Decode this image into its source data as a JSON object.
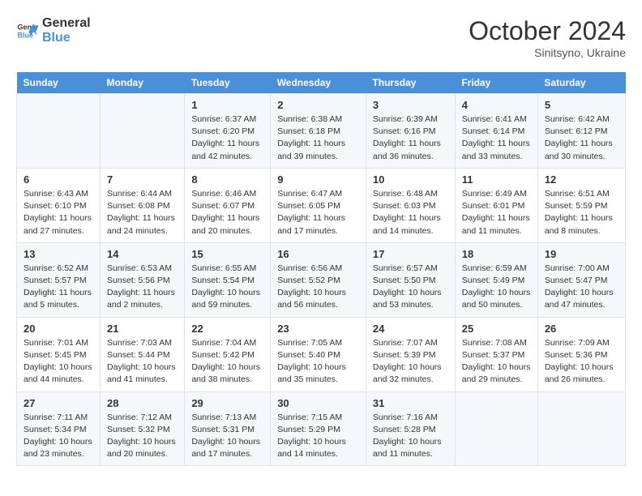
{
  "header": {
    "logo_line1": "General",
    "logo_line2": "Blue",
    "month": "October 2024",
    "location": "Sinitsyno, Ukraine"
  },
  "columns": [
    "Sunday",
    "Monday",
    "Tuesday",
    "Wednesday",
    "Thursday",
    "Friday",
    "Saturday"
  ],
  "weeks": [
    [
      {
        "day": "",
        "content": ""
      },
      {
        "day": "",
        "content": ""
      },
      {
        "day": "1",
        "content": "Sunrise: 6:37 AM\nSunset: 6:20 PM\nDaylight: 11 hours and 42 minutes."
      },
      {
        "day": "2",
        "content": "Sunrise: 6:38 AM\nSunset: 6:18 PM\nDaylight: 11 hours and 39 minutes."
      },
      {
        "day": "3",
        "content": "Sunrise: 6:39 AM\nSunset: 6:16 PM\nDaylight: 11 hours and 36 minutes."
      },
      {
        "day": "4",
        "content": "Sunrise: 6:41 AM\nSunset: 6:14 PM\nDaylight: 11 hours and 33 minutes."
      },
      {
        "day": "5",
        "content": "Sunrise: 6:42 AM\nSunset: 6:12 PM\nDaylight: 11 hours and 30 minutes."
      }
    ],
    [
      {
        "day": "6",
        "content": "Sunrise: 6:43 AM\nSunset: 6:10 PM\nDaylight: 11 hours and 27 minutes."
      },
      {
        "day": "7",
        "content": "Sunrise: 6:44 AM\nSunset: 6:08 PM\nDaylight: 11 hours and 24 minutes."
      },
      {
        "day": "8",
        "content": "Sunrise: 6:46 AM\nSunset: 6:07 PM\nDaylight: 11 hours and 20 minutes."
      },
      {
        "day": "9",
        "content": "Sunrise: 6:47 AM\nSunset: 6:05 PM\nDaylight: 11 hours and 17 minutes."
      },
      {
        "day": "10",
        "content": "Sunrise: 6:48 AM\nSunset: 6:03 PM\nDaylight: 11 hours and 14 minutes."
      },
      {
        "day": "11",
        "content": "Sunrise: 6:49 AM\nSunset: 6:01 PM\nDaylight: 11 hours and 11 minutes."
      },
      {
        "day": "12",
        "content": "Sunrise: 6:51 AM\nSunset: 5:59 PM\nDaylight: 11 hours and 8 minutes."
      }
    ],
    [
      {
        "day": "13",
        "content": "Sunrise: 6:52 AM\nSunset: 5:57 PM\nDaylight: 11 hours and 5 minutes."
      },
      {
        "day": "14",
        "content": "Sunrise: 6:53 AM\nSunset: 5:56 PM\nDaylight: 11 hours and 2 minutes."
      },
      {
        "day": "15",
        "content": "Sunrise: 6:55 AM\nSunset: 5:54 PM\nDaylight: 10 hours and 59 minutes."
      },
      {
        "day": "16",
        "content": "Sunrise: 6:56 AM\nSunset: 5:52 PM\nDaylight: 10 hours and 56 minutes."
      },
      {
        "day": "17",
        "content": "Sunrise: 6:57 AM\nSunset: 5:50 PM\nDaylight: 10 hours and 53 minutes."
      },
      {
        "day": "18",
        "content": "Sunrise: 6:59 AM\nSunset: 5:49 PM\nDaylight: 10 hours and 50 minutes."
      },
      {
        "day": "19",
        "content": "Sunrise: 7:00 AM\nSunset: 5:47 PM\nDaylight: 10 hours and 47 minutes."
      }
    ],
    [
      {
        "day": "20",
        "content": "Sunrise: 7:01 AM\nSunset: 5:45 PM\nDaylight: 10 hours and 44 minutes."
      },
      {
        "day": "21",
        "content": "Sunrise: 7:03 AM\nSunset: 5:44 PM\nDaylight: 10 hours and 41 minutes."
      },
      {
        "day": "22",
        "content": "Sunrise: 7:04 AM\nSunset: 5:42 PM\nDaylight: 10 hours and 38 minutes."
      },
      {
        "day": "23",
        "content": "Sunrise: 7:05 AM\nSunset: 5:40 PM\nDaylight: 10 hours and 35 minutes."
      },
      {
        "day": "24",
        "content": "Sunrise: 7:07 AM\nSunset: 5:39 PM\nDaylight: 10 hours and 32 minutes."
      },
      {
        "day": "25",
        "content": "Sunrise: 7:08 AM\nSunset: 5:37 PM\nDaylight: 10 hours and 29 minutes."
      },
      {
        "day": "26",
        "content": "Sunrise: 7:09 AM\nSunset: 5:36 PM\nDaylight: 10 hours and 26 minutes."
      }
    ],
    [
      {
        "day": "27",
        "content": "Sunrise: 7:11 AM\nSunset: 5:34 PM\nDaylight: 10 hours and 23 minutes."
      },
      {
        "day": "28",
        "content": "Sunrise: 7:12 AM\nSunset: 5:32 PM\nDaylight: 10 hours and 20 minutes."
      },
      {
        "day": "29",
        "content": "Sunrise: 7:13 AM\nSunset: 5:31 PM\nDaylight: 10 hours and 17 minutes."
      },
      {
        "day": "30",
        "content": "Sunrise: 7:15 AM\nSunset: 5:29 PM\nDaylight: 10 hours and 14 minutes."
      },
      {
        "day": "31",
        "content": "Sunrise: 7:16 AM\nSunset: 5:28 PM\nDaylight: 10 hours and 11 minutes."
      },
      {
        "day": "",
        "content": ""
      },
      {
        "day": "",
        "content": ""
      }
    ]
  ]
}
